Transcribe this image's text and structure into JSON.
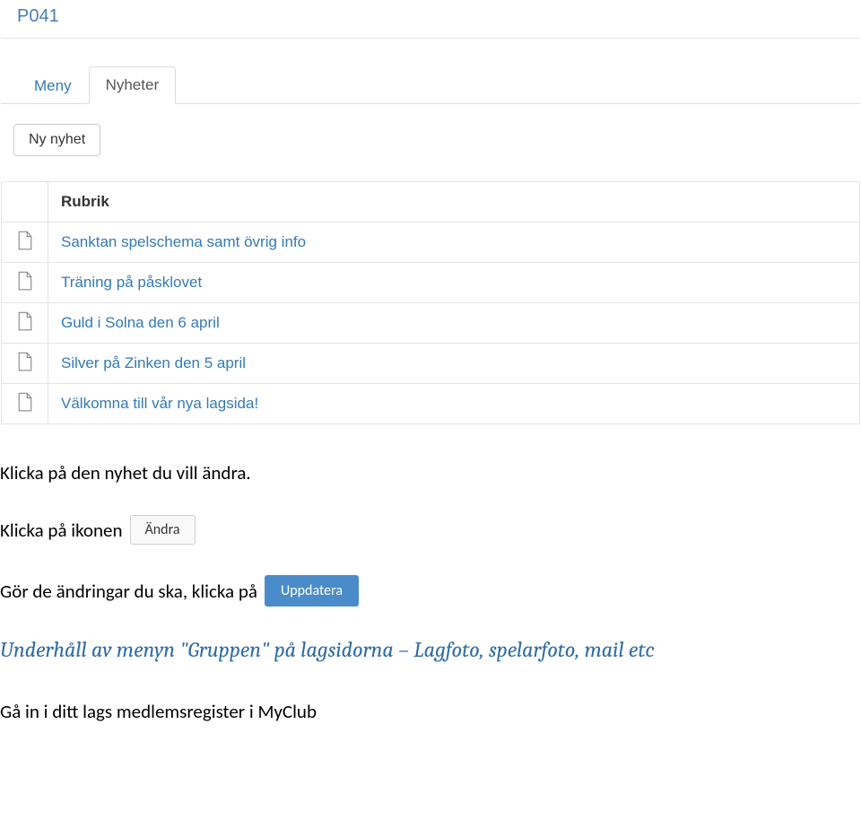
{
  "header": {
    "title": "P041"
  },
  "tabs": {
    "meny": "Meny",
    "nyheter": "Nyheter"
  },
  "buttons": {
    "ny_nyhet": "Ny nyhet",
    "andra": "Ändra",
    "uppdatera": "Uppdatera"
  },
  "table": {
    "header_rubrik": "Rubrik",
    "rows": [
      {
        "title": "Sanktan spelschema samt övrig info"
      },
      {
        "title": "Träning på påsklovet"
      },
      {
        "title": "Guld i Solna den 6 april"
      },
      {
        "title": "Silver på Zinken den 5 april"
      },
      {
        "title": "Välkomna till vår nya lagsida!"
      }
    ]
  },
  "instructions": {
    "line1": "Klicka på den nyhet du vill ändra.",
    "line2": "Klicka på ikonen",
    "line3": "Gör de ändringar du ska, klicka på",
    "heading": "Underhåll av menyn \"Gruppen\" på lagsidorna – Lagfoto, spelarfoto, mail etc",
    "line4": "Gå in i ditt lags medlemsregister i MyClub"
  }
}
